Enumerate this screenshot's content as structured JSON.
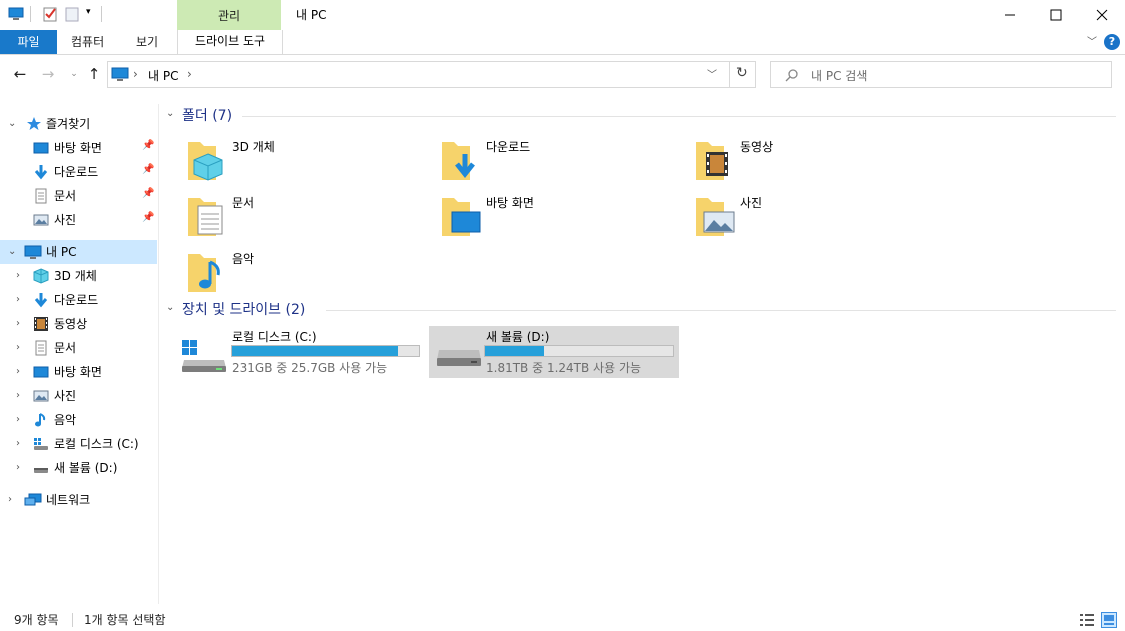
{
  "window": {
    "title": "내 PC",
    "contextual_tab": "관리",
    "minimize_icon": "minimize-icon",
    "maximize_icon": "maximize-icon",
    "close_icon": "close-icon"
  },
  "ribbon": {
    "file_tab": "파일",
    "tabs": [
      "컴퓨터",
      "보기"
    ],
    "drive_tools_tab": "드라이브 도구",
    "help_label": "?",
    "accent": "#1979ca"
  },
  "address": {
    "path": [
      "내 PC"
    ],
    "separator": "›",
    "search_placeholder": "내 PC 검색"
  },
  "sidebar": {
    "quick_access": {
      "label": "즐겨찾기",
      "items": [
        {
          "label": "바탕 화면",
          "icon": "desktop-icon"
        },
        {
          "label": "다운로드",
          "icon": "download-icon"
        },
        {
          "label": "문서",
          "icon": "document-icon"
        },
        {
          "label": "사진",
          "icon": "pictures-icon"
        }
      ]
    },
    "this_pc": {
      "label": "내 PC",
      "items": [
        {
          "label": "3D 개체",
          "icon": "3d-objects-icon"
        },
        {
          "label": "다운로드",
          "icon": "download-icon"
        },
        {
          "label": "동영상",
          "icon": "videos-icon"
        },
        {
          "label": "문서",
          "icon": "document-icon"
        },
        {
          "label": "바탕 화면",
          "icon": "desktop-icon"
        },
        {
          "label": "사진",
          "icon": "pictures-icon"
        },
        {
          "label": "음악",
          "icon": "music-icon"
        },
        {
          "label": "로컬 디스크 (C:)",
          "icon": "local-disk-icon"
        },
        {
          "label": "새 볼륨 (D:)",
          "icon": "drive-icon"
        }
      ]
    },
    "network": {
      "label": "네트워크",
      "icon": "network-icon"
    }
  },
  "content": {
    "folders_heading": "폴더 (7)",
    "folders": [
      {
        "label": "3D 개체",
        "icon": "3d-objects-folder-icon"
      },
      {
        "label": "다운로드",
        "icon": "downloads-folder-icon"
      },
      {
        "label": "동영상",
        "icon": "videos-folder-icon"
      },
      {
        "label": "문서",
        "icon": "documents-folder-icon"
      },
      {
        "label": "바탕 화면",
        "icon": "desktop-folder-icon"
      },
      {
        "label": "사진",
        "icon": "pictures-folder-icon"
      },
      {
        "label": "음악",
        "icon": "music-folder-icon"
      }
    ],
    "drives_heading": "장치 및 드라이브 (2)",
    "drives": [
      {
        "label": "로컬 디스크 (C:)",
        "free_text": "231GB 중 25.7GB 사용 가능",
        "used_fraction": 0.889,
        "selected": false
      },
      {
        "label": "새 볼륨 (D:)",
        "free_text": "1.81TB 중 1.24TB 사용 가능",
        "used_fraction": 0.315,
        "selected": true
      }
    ]
  },
  "status": {
    "item_count": "9개 항목",
    "selection": "1개 항목 선택함"
  },
  "colors": {
    "folder": "#f6d36b",
    "heading": "#1e3287",
    "progress": "#26a0da",
    "selection": "#cce8ff"
  }
}
